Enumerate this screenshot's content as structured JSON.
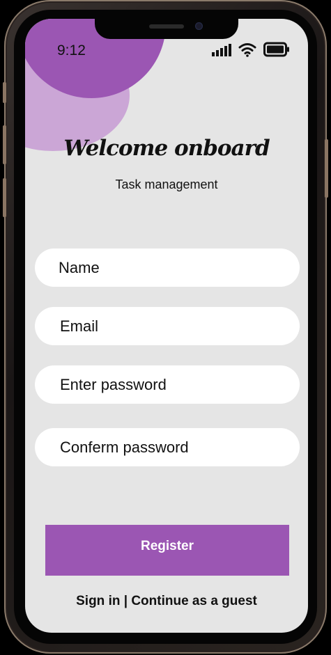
{
  "status_bar": {
    "time": "9:12",
    "icons": [
      "signal-icon",
      "wifi-icon",
      "battery-icon"
    ]
  },
  "header": {
    "title": "Welcome onboard",
    "subtitle": "Task management"
  },
  "form": {
    "name_placeholder": "Name",
    "email_placeholder": "Email",
    "password_placeholder": "Enter password",
    "confirm_placeholder": "Conferm password"
  },
  "actions": {
    "register_label": "Register",
    "sign_in_label": "Sign in",
    "separator": " | ",
    "guest_label": "Continue as a guest"
  },
  "colors": {
    "accent": "#9b56b3",
    "accent_light": "#cba6d6",
    "background": "#e5e5e5"
  }
}
